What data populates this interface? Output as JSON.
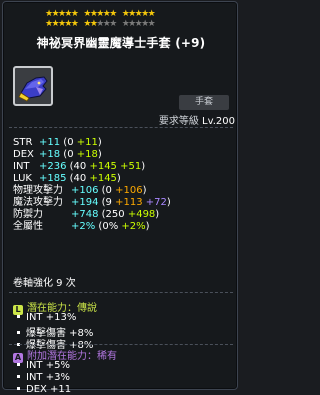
{
  "stars": {
    "row1_filled": 15,
    "row1_total": 15,
    "row2_filled": 7,
    "row2_total": 15
  },
  "title": "神祕冥界幽靈魔導士手套 (+9)",
  "item_type": "手套",
  "requirement": {
    "label": "要求等級",
    "value": "Lv.200"
  },
  "stats": [
    {
      "name": "STR",
      "total": "+11",
      "breakdown": [
        {
          "text": " (0 ",
          "color": "white"
        },
        {
          "text": "+11",
          "color": "yellow"
        },
        {
          "text": ")",
          "color": "white"
        }
      ]
    },
    {
      "name": "DEX",
      "total": "+18",
      "breakdown": [
        {
          "text": " (0 ",
          "color": "white"
        },
        {
          "text": "+18",
          "color": "yellow"
        },
        {
          "text": ")",
          "color": "white"
        }
      ]
    },
    {
      "name": "INT",
      "total": "+236",
      "breakdown": [
        {
          "text": " (40 ",
          "color": "white"
        },
        {
          "text": "+145",
          "color": "yellow"
        },
        {
          "text": " ",
          "color": "white"
        },
        {
          "text": "+51",
          "color": "yellow"
        },
        {
          "text": ")",
          "color": "white"
        }
      ]
    },
    {
      "name": "LUK",
      "total": "+185",
      "breakdown": [
        {
          "text": " (40 ",
          "color": "white"
        },
        {
          "text": "+145",
          "color": "yellow"
        },
        {
          "text": ")",
          "color": "white"
        }
      ]
    },
    {
      "name": "物理攻擊力",
      "total": "+106",
      "breakdown": [
        {
          "text": " (0 ",
          "color": "white"
        },
        {
          "text": "+106",
          "color": "orange"
        },
        {
          "text": ")",
          "color": "white"
        }
      ]
    },
    {
      "name": "魔法攻擊力",
      "total": "+194",
      "breakdown": [
        {
          "text": " (9 ",
          "color": "white"
        },
        {
          "text": "+113",
          "color": "orange"
        },
        {
          "text": " ",
          "color": "white"
        },
        {
          "text": "+72",
          "color": "purple"
        },
        {
          "text": ")",
          "color": "white"
        }
      ]
    },
    {
      "name": "防禦力",
      "total": "+748",
      "breakdown": [
        {
          "text": " (250 ",
          "color": "white"
        },
        {
          "text": "+498",
          "color": "yellow"
        },
        {
          "text": ")",
          "color": "white"
        }
      ]
    },
    {
      "name": "全屬性",
      "total": "+2%",
      "breakdown": [
        {
          "text": " (0% ",
          "color": "white"
        },
        {
          "text": "+2%",
          "color": "yellow"
        },
        {
          "text": ")",
          "color": "white"
        }
      ]
    }
  ],
  "scroll": "卷軸強化 9 次",
  "potential": {
    "badge": "L",
    "label": "潛在能力：傳說",
    "lines": [
      "INT +13%",
      "爆擊傷害 +8%",
      "爆擊傷害 +8%"
    ]
  },
  "additional_potential": {
    "badge": "A",
    "label": "附加潛在能力：稀有",
    "lines": [
      "INT +5%",
      "INT +3%",
      "DEX +11"
    ]
  },
  "colors": {
    "total": "#66ffff",
    "white": "#ffffff",
    "yellow": "#ccff00",
    "purple": "#aa88ff",
    "orange": "#ffaa00",
    "legendary": "#cbe548",
    "rare_label": "#b277e0"
  },
  "icon": "magician-glove-icon"
}
